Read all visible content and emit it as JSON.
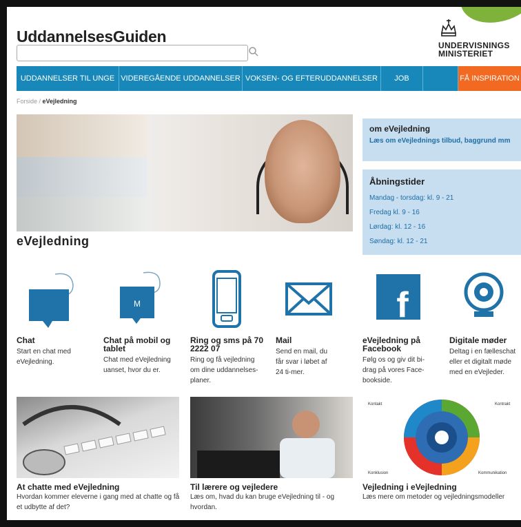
{
  "site": {
    "logo": "UddannelsesGuiden",
    "search": {
      "placeholder": "",
      "value": ""
    },
    "ministry_line1": "UNDERVISNINGS",
    "ministry_line2": "MINISTERIET"
  },
  "nav": {
    "items": [
      {
        "label": "UDDANNELSER TIL UNGE"
      },
      {
        "label": "VIDEREGÅENDE UDDANNELSER"
      },
      {
        "label": "VOKSEN- OG EFTERUDDANNELSER"
      },
      {
        "label": "JOB"
      },
      {
        "label": "FÅ INSPIRATION"
      }
    ]
  },
  "breadcrumb": {
    "home": "Forside",
    "sep": " / ",
    "current": "eVejledning"
  },
  "hero": {
    "title": "eVejledning"
  },
  "about": {
    "title": "om eVejledning",
    "link": "Læs om eVejlednings tilbud, baggrund mm"
  },
  "hours": {
    "title": "Åbningstider",
    "lines": [
      "Mandag  - torsdag: kl. 9 - 21",
      "Fredag kl. 9 - 16",
      "Lørdag: kl. 12 - 16",
      "Søndag: kl. 12 - 21"
    ]
  },
  "channels": [
    {
      "icon": "chat-bubble-icon",
      "title": "Chat",
      "text": "Start en chat med eVejledning."
    },
    {
      "icon": "mobile-chat-icon",
      "icon_letter": "M",
      "title": "Chat på mobil og tablet",
      "text": "Chat med eVejledning uanset, hvor du er."
    },
    {
      "icon": "phone-icon",
      "title": "Ring og sms på 70 2222 07",
      "text": "Ring og få vejledning om dine uddannelses-planer."
    },
    {
      "icon": "mail-icon",
      "title": "Mail",
      "text": "Send en mail, du får svar i løbet af 24 ti-mer."
    },
    {
      "icon": "facebook-icon",
      "icon_letter": "f",
      "title": "eVejledning på Facebook",
      "text": "Følg os og giv dit bi-drag på vores Face-bookside."
    },
    {
      "icon": "webcam-icon",
      "title": "Digitale møder",
      "text": "Deltag i en fælleschat eller et digitalt møde med en eVejleder."
    }
  ],
  "bottom": [
    {
      "title": "At chatte med eVejledning",
      "text": "Hvordan kommer eleverne i gang med at chatte og få et udbytte af det?"
    },
    {
      "title": "Til lærere og vejledere",
      "text": "Læs om, hvad du kan bruge eVejledning til - og hvordan."
    },
    {
      "title": "Vejledning i eVejledning",
      "text": "Læs mere om metoder og vejledningsmodeller",
      "wheel_labels": [
        "Kontakt",
        "Kontrakt",
        "Konklusion",
        "Kommunikation"
      ]
    }
  ],
  "colors": {
    "nav": "#1788b9",
    "accent": "#f26a21",
    "icon_blue": "#1f73a8",
    "side_bg": "#c7ddf0",
    "link": "#1d6fa5"
  }
}
